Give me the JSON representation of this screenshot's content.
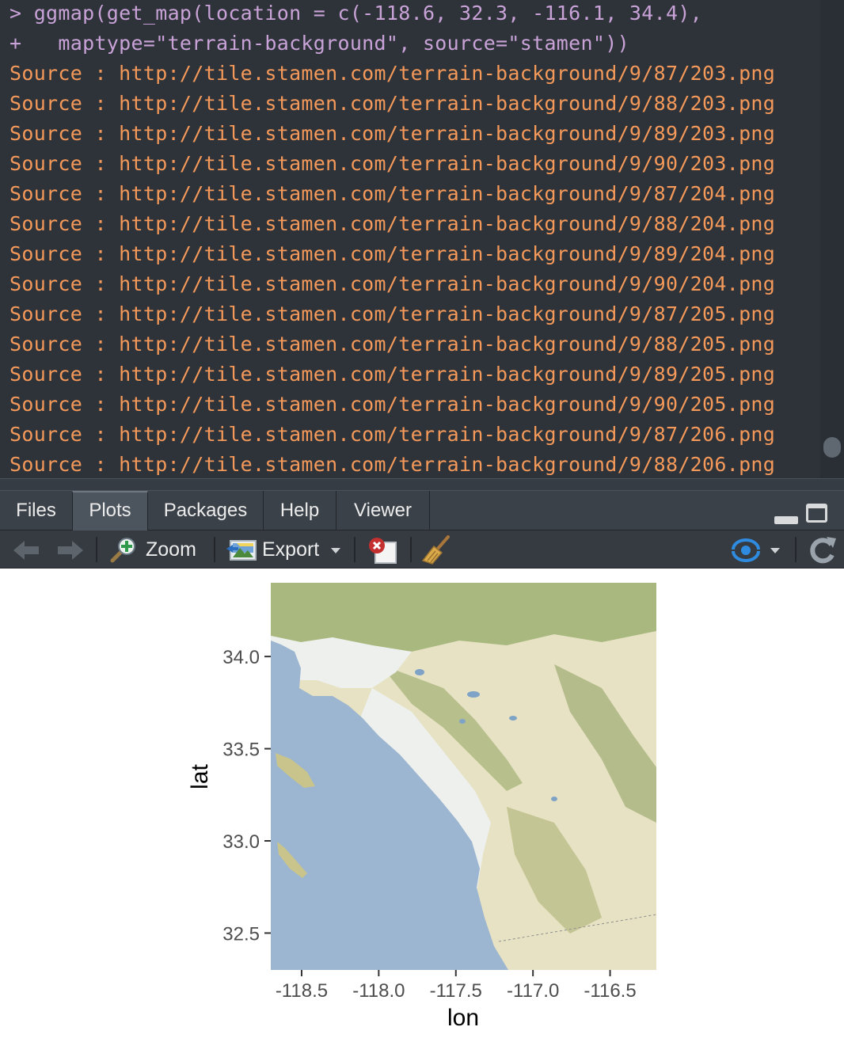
{
  "console": {
    "lines": [
      {
        "kind": "cmd",
        "text": "> ggmap(get_map(location = c(-118.6, 32.3, -116.1, 34.4),"
      },
      {
        "kind": "cmd",
        "text": "+   maptype=\"terrain-background\", source=\"stamen\"))"
      },
      {
        "kind": "src",
        "text": "Source : http://tile.stamen.com/terrain-background/9/87/203.png"
      },
      {
        "kind": "src",
        "text": "Source : http://tile.stamen.com/terrain-background/9/88/203.png"
      },
      {
        "kind": "src",
        "text": "Source : http://tile.stamen.com/terrain-background/9/89/203.png"
      },
      {
        "kind": "src",
        "text": "Source : http://tile.stamen.com/terrain-background/9/90/203.png"
      },
      {
        "kind": "src",
        "text": "Source : http://tile.stamen.com/terrain-background/9/87/204.png"
      },
      {
        "kind": "src",
        "text": "Source : http://tile.stamen.com/terrain-background/9/88/204.png"
      },
      {
        "kind": "src",
        "text": "Source : http://tile.stamen.com/terrain-background/9/89/204.png"
      },
      {
        "kind": "src",
        "text": "Source : http://tile.stamen.com/terrain-background/9/90/204.png"
      },
      {
        "kind": "src",
        "text": "Source : http://tile.stamen.com/terrain-background/9/87/205.png"
      },
      {
        "kind": "src",
        "text": "Source : http://tile.stamen.com/terrain-background/9/88/205.png"
      },
      {
        "kind": "src",
        "text": "Source : http://tile.stamen.com/terrain-background/9/89/205.png"
      },
      {
        "kind": "src",
        "text": "Source : http://tile.stamen.com/terrain-background/9/90/205.png"
      },
      {
        "kind": "src",
        "text": "Source : http://tile.stamen.com/terrain-background/9/87/206.png"
      },
      {
        "kind": "src",
        "text": "Source : http://tile.stamen.com/terrain-background/9/88/206.png"
      }
    ],
    "colors": {
      "background": "#2e3339",
      "command": "#c9a3d8",
      "output": "#f4995a"
    }
  },
  "pane": {
    "tabs": [
      {
        "label": "Files",
        "active": false
      },
      {
        "label": "Plots",
        "active": true
      },
      {
        "label": "Packages",
        "active": false
      },
      {
        "label": "Help",
        "active": false
      },
      {
        "label": "Viewer",
        "active": false
      }
    ],
    "window_icons": [
      "minimize-icon",
      "maximize-icon"
    ]
  },
  "toolbar": {
    "back_icon": "arrow-left-icon",
    "forward_icon": "arrow-right-icon",
    "zoom_label": "Zoom",
    "zoom_icon": "magnifier-plus-icon",
    "export_label": "Export",
    "export_icon": "image-export-icon",
    "remove_icon": "remove-plot-icon",
    "clear_icon": "broom-icon",
    "publish_icon": "publish-icon",
    "refresh_icon": "refresh-icon"
  },
  "chart_data": {
    "type": "map",
    "basemap": "terrain-background",
    "xlabel": "lon",
    "ylabel": "lat",
    "xlim": [
      -118.7,
      -116.2
    ],
    "ylim": [
      32.3,
      34.4
    ],
    "x_ticks": [
      {
        "value": -118.5,
        "label": "-118.5"
      },
      {
        "value": -118.0,
        "label": "-118.0"
      },
      {
        "value": -117.5,
        "label": "-117.5"
      },
      {
        "value": -117.0,
        "label": "-117.0"
      },
      {
        "value": -116.5,
        "label": "-116.5"
      }
    ],
    "y_ticks": [
      {
        "value": 34.0,
        "label": "34.0"
      },
      {
        "value": 33.5,
        "label": "33.5"
      },
      {
        "value": 33.0,
        "label": "33.0"
      },
      {
        "value": 32.5,
        "label": "32.5"
      }
    ],
    "colors": {
      "water": "#9cb5d0",
      "land": "#e6e2c3",
      "vegetation": "#a8b87e",
      "urban": "#eef0ee"
    }
  }
}
